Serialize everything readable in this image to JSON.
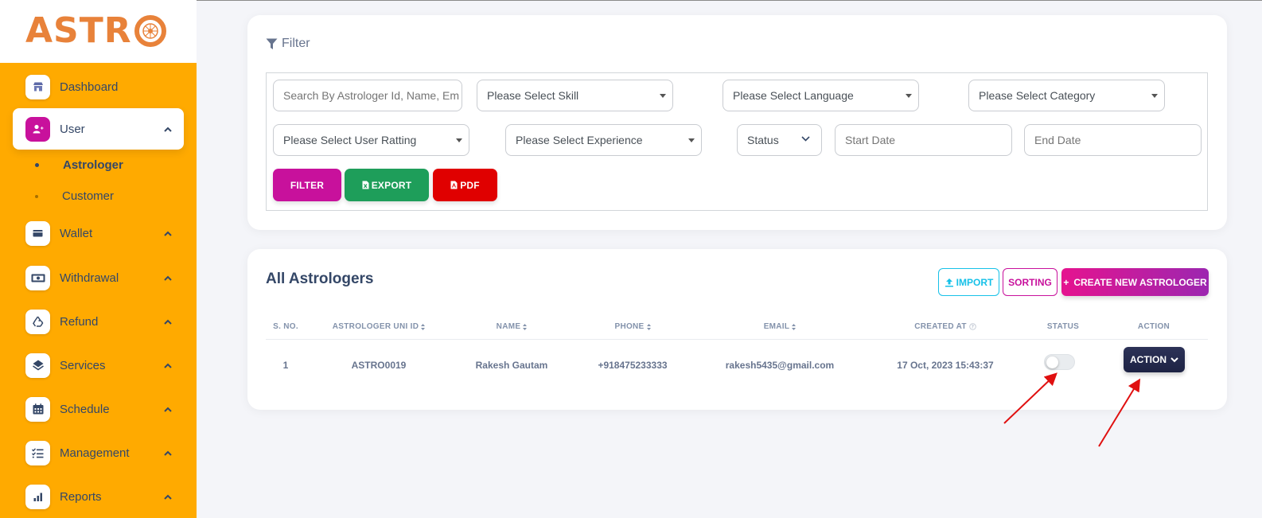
{
  "app": {
    "logo_text": "ASTR"
  },
  "sidebar": {
    "items": [
      {
        "label": "Dashboard",
        "icon": "shop-icon"
      },
      {
        "label": "User",
        "icon": "user-add-icon",
        "active": true
      },
      {
        "label": "Wallet",
        "icon": "wallet-icon"
      },
      {
        "label": "Withdrawal",
        "icon": "money-icon"
      },
      {
        "label": "Refund",
        "icon": "recycle-icon"
      },
      {
        "label": "Services",
        "icon": "layers-icon"
      },
      {
        "label": "Schedule",
        "icon": "calendar-icon"
      },
      {
        "label": "Management",
        "icon": "checklist-icon"
      },
      {
        "label": "Reports",
        "icon": "bar-chart-icon"
      }
    ],
    "subitems": [
      {
        "label": "Astrologer",
        "active": true
      },
      {
        "label": "Customer",
        "active": false
      }
    ]
  },
  "filter": {
    "title": "Filter",
    "search_placeholder": "Search By Astrologer Id, Name, Em",
    "skill": "Please Select Skill",
    "language": "Please Select Language",
    "category": "Please Select Category",
    "rating": "Please Select User Ratting",
    "experience": "Please Select Experience",
    "status": "Status",
    "start_date_placeholder": "Start Date",
    "end_date_placeholder": "End Date",
    "filter_btn": "FILTER",
    "export_btn": "EXPORT",
    "pdf_btn": "PDF"
  },
  "list": {
    "title": "All Astrologers",
    "import_btn": "IMPORT",
    "sorting_btn": "SORTING",
    "create_btn": "CREATE NEW ASTROLOGER",
    "columns": [
      "S. NO.",
      "ASTROLOGER UNI ID",
      "NAME",
      "PHONE",
      "EMAIL",
      "CREATED AT",
      "STATUS",
      "ACTION"
    ],
    "rows": [
      {
        "sno": "1",
        "uni_id": "ASTRO0019",
        "name": "Rakesh Gautam",
        "phone": "+918475233333",
        "email": "rakesh5435@gmail.com",
        "created_at": "17 Oct, 2023 15:43:37",
        "status_on": false,
        "action": "ACTION"
      }
    ]
  },
  "colors": {
    "sidebar_bg": "#ffaa00",
    "brand_orange": "#e8823a",
    "active_icon": "#c8119c",
    "filter_btn": "#c8119c",
    "export_btn": "#1e9e5a",
    "pdf_btn": "#e00000",
    "action_btn": "#2c3257",
    "annotation_arrow": "#e01010"
  }
}
